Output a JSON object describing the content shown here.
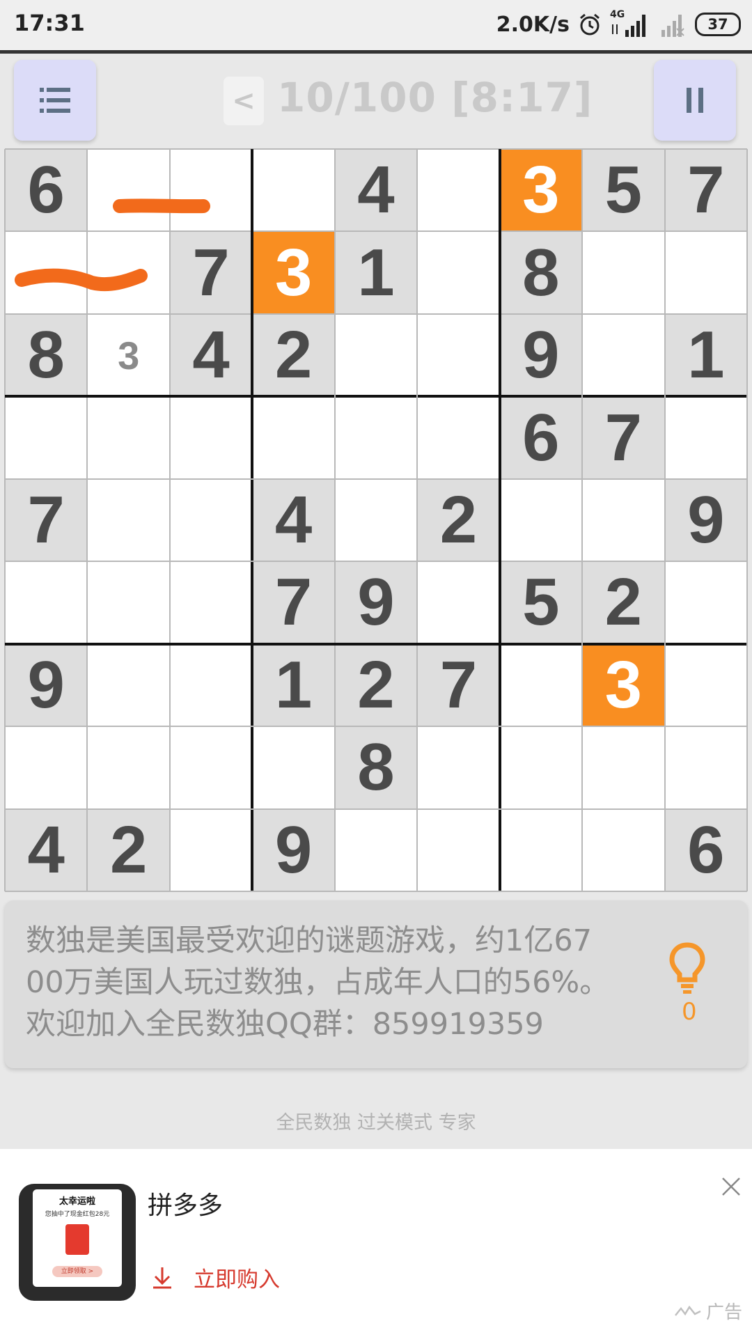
{
  "status_bar": {
    "time": "17:31",
    "net_speed": "2.0K/s",
    "network_type": "4G",
    "battery": "37",
    "icons": [
      "alarm-icon",
      "signal-icon",
      "signal-x-icon",
      "battery-icon"
    ]
  },
  "header": {
    "back_label": "<",
    "title": "10/100 [8:17]",
    "menu_icon": "list-icon",
    "pause_icon": "pause-icon"
  },
  "colors": {
    "highlight": "#f98e21",
    "given_cell": "#dedede",
    "empty_cell": "#ffffff",
    "button_bg": "#dcdcf8",
    "scribble": "#f26a1b",
    "ad_accent": "#d63a2e"
  },
  "board": {
    "rows": [
      [
        "6",
        "",
        "",
        "",
        "4",
        "",
        "3",
        "5",
        "7"
      ],
      [
        "",
        "",
        "7",
        "3",
        "1",
        "",
        "8",
        "",
        ""
      ],
      [
        "8",
        "",
        "4",
        "2",
        "",
        "",
        "9",
        "",
        "1"
      ],
      [
        "",
        "",
        "",
        "",
        "",
        "",
        "6",
        "7",
        ""
      ],
      [
        "7",
        "",
        "",
        "4",
        "",
        "2",
        "",
        "",
        "9"
      ],
      [
        "",
        "",
        "",
        "7",
        "9",
        "",
        "5",
        "2",
        ""
      ],
      [
        "9",
        "",
        "",
        "1",
        "2",
        "7",
        "",
        "3",
        ""
      ],
      [
        "",
        "",
        "",
        "",
        "8",
        "",
        "",
        "",
        ""
      ],
      [
        "4",
        "2",
        "",
        "9",
        "",
        "",
        "",
        "",
        "6"
      ]
    ],
    "highlighted": [
      [
        0,
        6
      ],
      [
        1,
        3
      ],
      [
        6,
        7
      ]
    ],
    "pencil_marks": [
      {
        "row": 2,
        "col": 1,
        "value": "3"
      }
    ],
    "selected_digit": "3"
  },
  "info": {
    "line1": "数独是美国最受欢迎的谜题游戏，约1亿67",
    "line2": "00万美国人玩过数独，占成年人口的56%。",
    "line3": "欢迎加入全民数独QQ群：859919359",
    "hint_icon": "lightbulb-icon",
    "hint_count": "0"
  },
  "mode_label": "全民数独 过关模式 专家",
  "ad": {
    "thumb_title": "太幸运啦",
    "thumb_sub": "您抽中了现金红包28元",
    "thumb_button": "立即领取 >",
    "name": "拼多多",
    "buy_label": "立即购入",
    "buy_icon": "download-icon",
    "close_icon": "close-icon",
    "ad_label": "广告"
  }
}
